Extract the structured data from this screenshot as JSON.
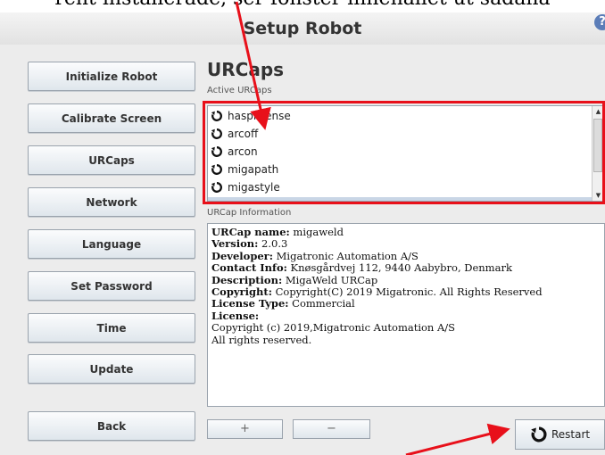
{
  "caption": "rent installerade, ser fönster innehållet ut sådana",
  "window": {
    "title": "Setup Robot"
  },
  "sidebar": {
    "items": [
      {
        "label": "Initialize Robot"
      },
      {
        "label": "Calibrate Screen"
      },
      {
        "label": "URCaps"
      },
      {
        "label": "Network"
      },
      {
        "label": "Language"
      },
      {
        "label": "Set Password"
      },
      {
        "label": "Time"
      },
      {
        "label": "Update"
      }
    ],
    "back_label": "Back"
  },
  "main": {
    "heading": "URCaps",
    "active_label": "Active URCaps",
    "urcaps": [
      {
        "name": "hasplicense",
        "icon": "restart-icon"
      },
      {
        "name": "arcoff",
        "icon": "restart-icon"
      },
      {
        "name": "arcon",
        "icon": "restart-icon"
      },
      {
        "name": "migapath",
        "icon": "restart-icon"
      },
      {
        "name": "migastyle",
        "icon": "restart-icon"
      }
    ],
    "info_label": "URCap Information",
    "info": {
      "name_key": "URCap name:",
      "name": " migaweld",
      "version_key": "Version:",
      "version": " 2.0.3",
      "developer_key": "Developer:",
      "developer": " Migatronic Automation A/S",
      "contact_key": "Contact Info:",
      "contact": " Knøsgårdvej 112, 9440 Aabybro, Denmark",
      "description_key": "Description:",
      "description": " MigaWeld URCap",
      "copyright_key": "Copyright:",
      "copyright": " Copyright(C) 2019 Migatronic. All Rights Reserved",
      "license_type_key": "License Type:",
      "license_type": " Commercial",
      "license_key": "License:",
      "license_line1": "Copyright (c) 2019,Migatronic Automation A/S",
      "license_line2": "All rights reserved."
    },
    "add_label": "+",
    "remove_label": "−",
    "restart_label": "Restart"
  },
  "colors": {
    "highlight": "#e8101a",
    "arrow": "#e8101a",
    "help": "#5b7db8"
  }
}
